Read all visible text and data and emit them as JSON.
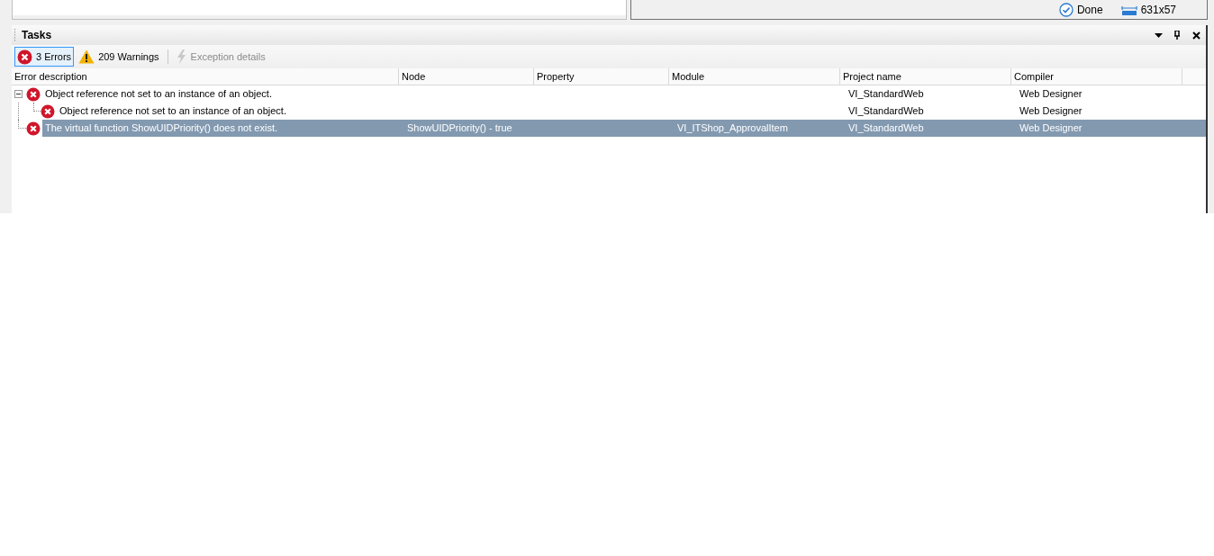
{
  "status": {
    "state": "Done",
    "size": "631x57"
  },
  "tasks_panel": {
    "title": "Tasks",
    "filters": [
      {
        "kind": "errors",
        "label": "3 Errors",
        "selected": true,
        "disabled": false
      },
      {
        "kind": "warnings",
        "label": "209 Warnings",
        "selected": false,
        "disabled": false
      },
      {
        "kind": "exception",
        "label": "Exception details",
        "selected": false,
        "disabled": true
      }
    ],
    "table": {
      "columns": [
        "Error description",
        "Node",
        "Property",
        "Module",
        "Project name",
        "Compiler"
      ],
      "rows": [
        {
          "description": "Object reference not set to an instance of an object.",
          "project": "VI_StandardWeb",
          "compiler": "Web Designer",
          "selected": false,
          "expanded": true,
          "children": [
            {
              "description": "Object reference not set to an instance of an object.",
              "project": "VI_StandardWeb",
              "compiler": "Web Designer",
              "selected": false
            }
          ]
        },
        {
          "description": "The virtual function ShowUIDPriority() does not exist.",
          "node": "ShowUIDPriority() - true",
          "module": "VI_ITShop_ApprovalItem",
          "project": "VI_StandardWeb",
          "compiler": "Web Designer",
          "selected": true,
          "expanded": false
        }
      ]
    }
  }
}
